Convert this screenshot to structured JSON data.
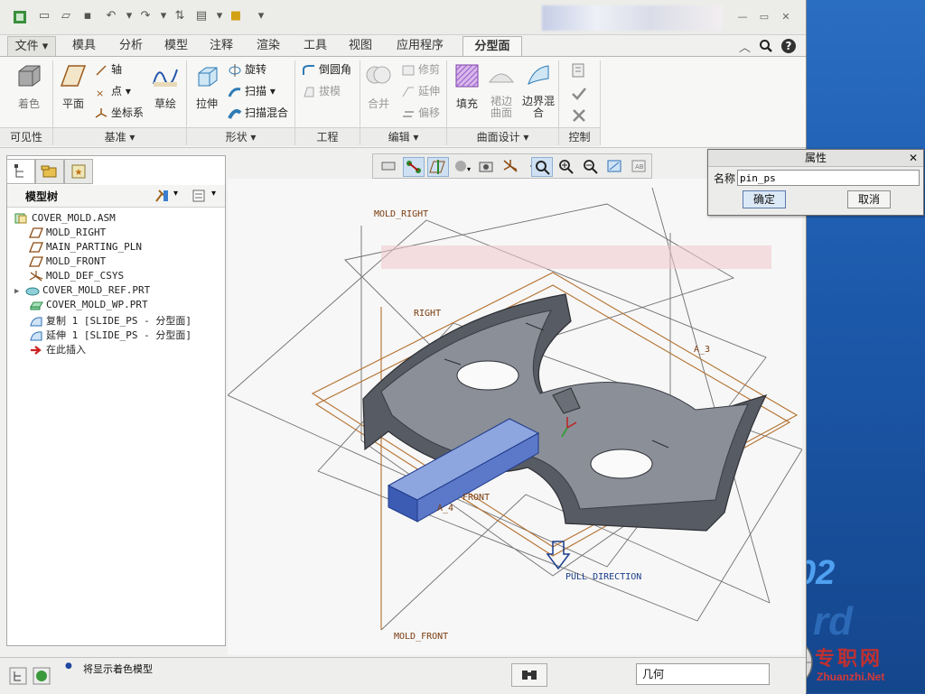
{
  "ribbon_tabs": [
    "文件",
    "模具",
    "分析",
    "模型",
    "注释",
    "渲染",
    "工具",
    "视图",
    "应用程序",
    "分型面"
  ],
  "groups": {
    "visibility": {
      "label": "可见性",
      "shade": "着色"
    },
    "datum": {
      "label": "基准",
      "plane": "平面",
      "axis": "轴",
      "point": "点",
      "csys": "坐标系",
      "sketch": "草绘"
    },
    "shapes": {
      "label": "形状",
      "extrude": "拉伸",
      "revolve": "旋转",
      "sweep": "扫描",
      "swept_blend": "扫描混合"
    },
    "engineering": {
      "label": "工程",
      "round": "倒圆角",
      "draft": "拔模"
    },
    "editing": {
      "label": "编辑",
      "merge": "合并",
      "trim": "修剪",
      "extend": "延伸",
      "offset": "偏移"
    },
    "surface_design": {
      "label": "曲面设计",
      "fill": "填充",
      "skirt": "裙边曲面",
      "boundary_blend": "边界混合"
    },
    "control": {
      "label": "控制"
    }
  },
  "tree": {
    "title": "模型树",
    "items": [
      {
        "label": "COVER_MOLD.ASM",
        "icon": "assembly-icon"
      },
      {
        "label": "MOLD_RIGHT",
        "icon": "datum-plane-icon"
      },
      {
        "label": "MAIN_PARTING_PLN",
        "icon": "datum-plane-icon"
      },
      {
        "label": "MOLD_FRONT",
        "icon": "datum-plane-icon"
      },
      {
        "label": "MOLD_DEF_CSYS",
        "icon": "csys-icon"
      },
      {
        "label": "COVER_MOLD_REF.PRT",
        "icon": "part-icon"
      },
      {
        "label": "COVER_MOLD_WP.PRT",
        "icon": "workpiece-icon"
      },
      {
        "label": "复制 1 [SLIDE_PS - 分型面]",
        "icon": "surface-icon"
      },
      {
        "label": "延伸 1 [SLIDE_PS - 分型面]",
        "icon": "surface-icon"
      },
      {
        "label": "在此插入",
        "icon": "insert-arrow-icon"
      }
    ]
  },
  "viewport": {
    "labels": {
      "mold_right": "MOLD_RIGHT",
      "right": "RIGHT",
      "front": "FRONT",
      "mold_front": "MOLD_FRONT",
      "pull_direction": "PULL DIRECTION",
      "a3": "A_3",
      "a4": "A_4"
    }
  },
  "dialog": {
    "title": "属性",
    "name_label": "名称",
    "name_value": "pin_ps",
    "ok": "确定",
    "cancel": "取消"
  },
  "status": {
    "message": "将显示着色模型",
    "filter": "几何"
  },
  "desktop": {
    "text": "02",
    "site_cn": "专职网",
    "site_url": "Zhuanzhi.Net"
  }
}
